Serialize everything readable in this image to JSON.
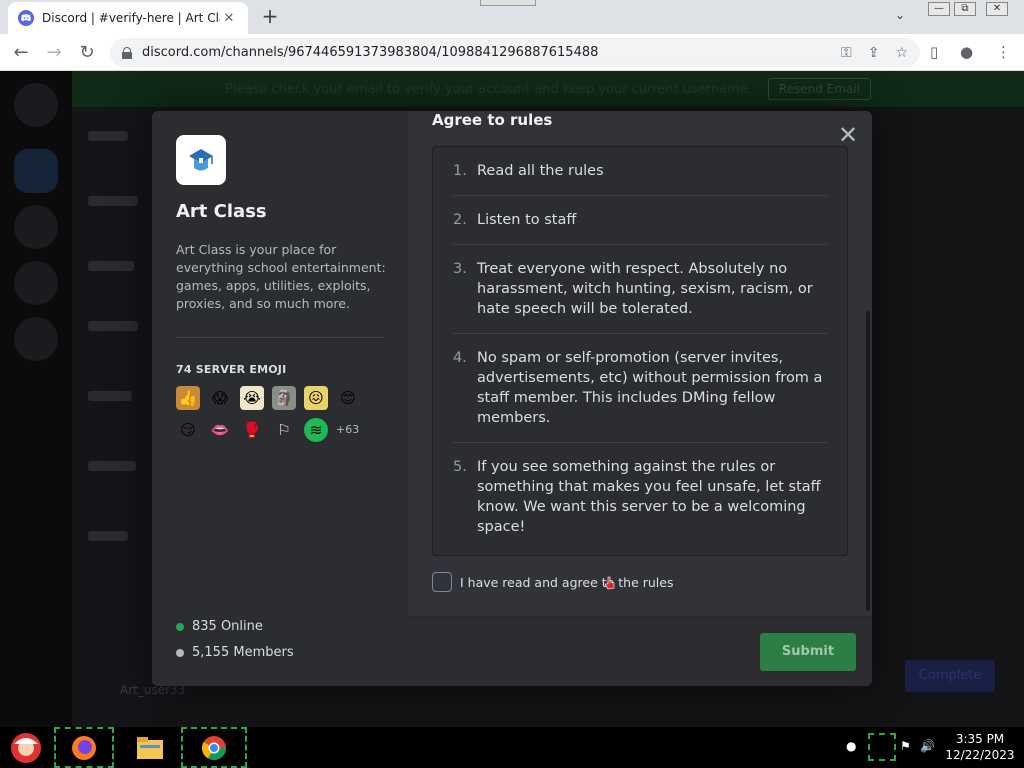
{
  "browser": {
    "tab_title": "Discord | #verify-here | Art Class",
    "tab_close": "✕",
    "new_tab": "+",
    "url": "discord.com/channels/967446591373983804/1098841296887615488",
    "tab_search": "⌄",
    "win_min": "—",
    "win_restore": "⧉",
    "win_close": "✕"
  },
  "discord_bg": {
    "notice_text": "Please check your email to verify your account and keep your current username.",
    "notice_button": "Resend Email",
    "complete_button": "Complete",
    "user_name": "Art_user33"
  },
  "modal": {
    "server_name": "Art Class",
    "server_description": "Art Class is your place for everything school entertainment: games, apps, utilities, exploits, proxies, and so much more.",
    "emoji_heading": "74 SERVER EMOJI",
    "emoji_more": "+63",
    "online": "835 Online",
    "members": "5,155 Members",
    "rules_title": "Agree to rules",
    "close": "✕",
    "rules": [
      {
        "num": "1.",
        "text": "Read all the rules"
      },
      {
        "num": "2.",
        "text": "Listen to staff"
      },
      {
        "num": "3.",
        "text": "Treat everyone with respect. Absolutely no harassment, witch hunting, sexism, racism, or hate speech will be tolerated."
      },
      {
        "num": "4.",
        "text": "No spam or self-promotion (server invites, advertisements, etc) without permission from a staff member. This includes DMing fellow members."
      },
      {
        "num": "5.",
        "text": "If you see something against the rules or something that makes you feel unsafe, let staff know. We want this server to be a welcoming space!"
      }
    ],
    "agree_label": "I have read and agree to the rules",
    "submit": "Submit"
  },
  "taskbar": {
    "time": "3:35 PM",
    "date": "12/22/2023"
  },
  "colors": {
    "online": "#23a559",
    "members": "#b5bac1",
    "submit": "#2d7d46"
  }
}
